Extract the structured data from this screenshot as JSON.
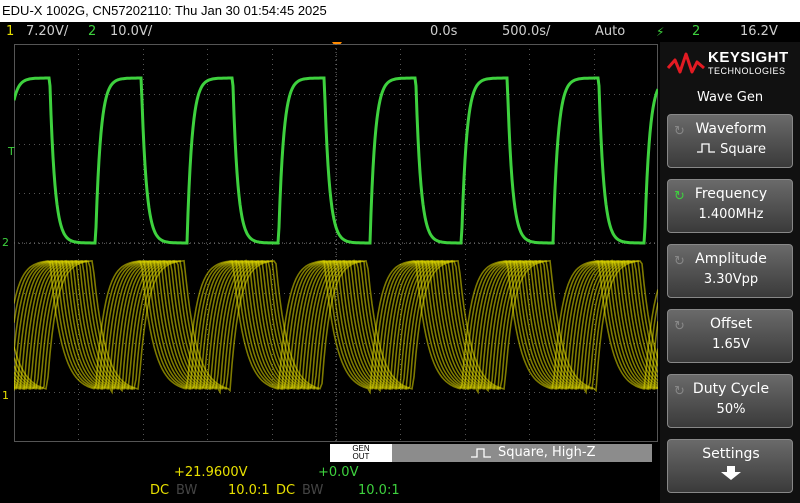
{
  "title": "EDU-X 1002G, CN57202110: Thu Jan 30 01:54:45 2025",
  "status": {
    "ch1_num": "1",
    "ch1_scale": "7.20V/",
    "ch2_num": "2",
    "ch2_scale": "10.0V/",
    "time_delay": "0.0s",
    "time_scale": "500.0s/",
    "trigger_mode": "Auto",
    "trigger_source": "2",
    "trigger_level": "16.2V"
  },
  "markers": {
    "trigger": "T",
    "ch2": "2",
    "ch1": "1"
  },
  "logo": {
    "word": "KEYSIGHT",
    "sub": "TECHNOLOGIES"
  },
  "panel": {
    "title": "Wave Gen",
    "keys": [
      {
        "label": "Waveform",
        "value": "Square",
        "active": false
      },
      {
        "label": "Frequency",
        "value": "1.400MHz",
        "active": true
      },
      {
        "label": "Amplitude",
        "value": "3.30Vpp",
        "active": false
      },
      {
        "label": "Offset",
        "value": "1.65V",
        "active": false
      },
      {
        "label": "Duty Cycle",
        "value": "50%",
        "active": false
      },
      {
        "label": "Settings",
        "value": "",
        "active": false
      }
    ]
  },
  "gen": {
    "badge_top": "GEN",
    "badge_bottom": "OUT",
    "status": "Square, High-Z"
  },
  "bottom": {
    "ch1_offset": "+21.9600V",
    "ch2_offset": "+0.0V",
    "ch1_coupling": "DC",
    "ch1_bw": "BW",
    "ch1_probe": "10.0:1",
    "ch2_coupling": "DC",
    "ch2_bw": "BW",
    "ch2_probe": "10.0:1"
  },
  "colors": {
    "ch1": "#e8e000",
    "ch2": "#3ed13e",
    "trigger": "#ff8a00",
    "grid": "#555555"
  },
  "icons": {
    "waveform": "square-wave-icon",
    "knob": "rotate-knob-icon",
    "settings": "down-arrow-icon",
    "trigger": "trigger-edge-icon"
  }
}
